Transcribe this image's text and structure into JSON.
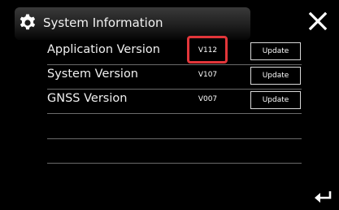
{
  "header": {
    "title": "System Information",
    "icon": "gear-icon"
  },
  "close_icon": "close-icon",
  "back_icon": "back-arrow-icon",
  "highlight_color": "#e2363a",
  "rows": [
    {
      "label": "Application Version",
      "value": "V112",
      "button": "Update"
    },
    {
      "label": "System Version",
      "value": "V107",
      "button": "Update"
    },
    {
      "label": "GNSS Version",
      "value": "V007",
      "button": "Update"
    }
  ]
}
